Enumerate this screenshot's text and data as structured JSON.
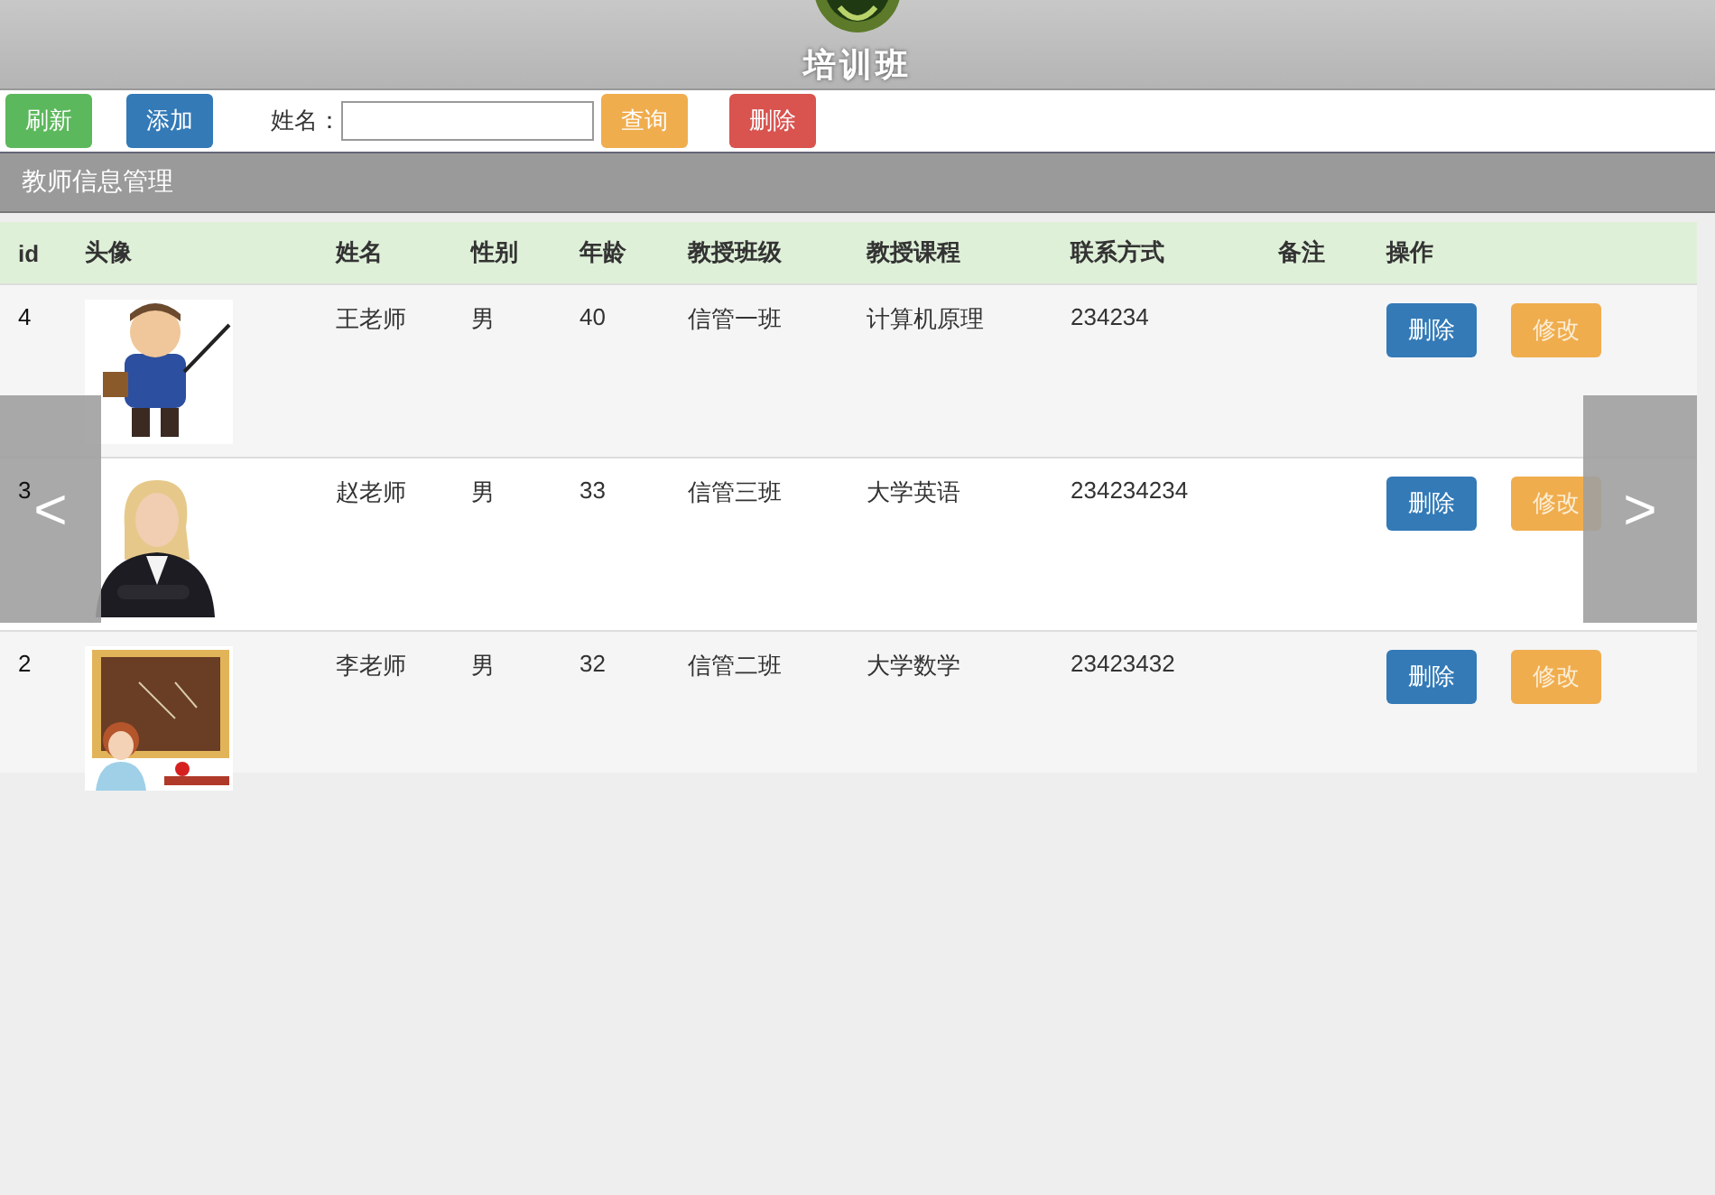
{
  "header": {
    "title": "培训班"
  },
  "toolbar": {
    "refresh": "刷新",
    "add": "添加",
    "name_label": "姓名：",
    "search": "查询",
    "delete": "删除"
  },
  "panel": {
    "title": "教师信息管理"
  },
  "table": {
    "columns": [
      "id",
      "头像",
      "姓名",
      "性别",
      "年龄",
      "教授班级",
      "教授课程",
      "联系方式",
      "备注",
      "操作"
    ],
    "rows": [
      {
        "id": "4",
        "avatar": {
          "kind": "picture"
        },
        "name": "王老师",
        "gender": "男",
        "age": "40",
        "class": "信管一班",
        "course": "计算机原理",
        "contact": "234234",
        "actions": [
          "删除",
          "修改"
        ]
      },
      {
        "id": "3",
        "avatar": {
          "kind": "picture"
        },
        "name": "赵老师",
        "gender": "男",
        "age": "33",
        "class": "信管三班",
        "course": "大学英语",
        "contact": "234234234",
        "actions": [
          "删除",
          "修改"
        ]
      },
      {
        "id": "2",
        "avatar": {
          "kind": "picture"
        },
        "name": "李老师",
        "gender": "男",
        "age": "32",
        "class": "信管二班",
        "course": "大学数学",
        "contact": "23423432",
        "actions": [
          "删除",
          "修改"
        ]
      }
    ]
  },
  "carousel": {
    "prev": "<",
    "next": ">"
  }
}
